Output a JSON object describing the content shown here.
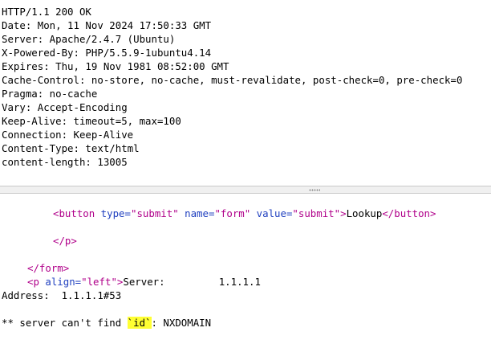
{
  "response_headers": [
    "HTTP/1.1 200 OK",
    "Date: Mon, 11 Nov 2024 17:50:33 GMT",
    "Server: Apache/2.4.7 (Ubuntu)",
    "X-Powered-By: PHP/5.5.9-1ubuntu4.14",
    "Expires: Thu, 19 Nov 1981 08:52:00 GMT",
    "Cache-Control: no-store, no-cache, must-revalidate, post-check=0, pre-check=0",
    "Pragma: no-cache",
    "Vary: Accept-Encoding",
    "Keep-Alive: timeout=5, max=100",
    "Connection: Keep-Alive",
    "Content-Type: text/html",
    "content-length: 13005"
  ],
  "body": {
    "button_open": "<button",
    "button_type_attr": " type=",
    "button_type_val": "\"submit\"",
    "button_name_attr": " name=",
    "button_name_val": "\"form\"",
    "button_value_attr": " value=",
    "button_value_val": "\"submit\"",
    "button_gt": ">",
    "button_text": "Lookup",
    "button_close": "</button>",
    "p_close": "</p>",
    "form_close": "</form>",
    "p_open": "<p",
    "p_align_attr": " align=",
    "p_align_val": "\"left\"",
    "p_gt": ">",
    "server_text": "Server:\t\t1.1.1.1",
    "address_text": "Address:  1.1.1.1#53",
    "error_prefix": "** server can't find ",
    "error_highlight": "`id`",
    "error_suffix": ": NXDOMAIN"
  }
}
